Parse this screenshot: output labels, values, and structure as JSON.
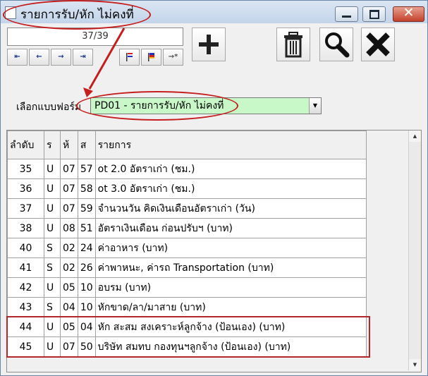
{
  "window": {
    "title": "รายการรับ/หัก ไม่คงที่",
    "minimize_icon": "minimize-icon",
    "maximize_icon": "maximize-icon",
    "close_symbol": "✕"
  },
  "record_counter": "37/39",
  "navigation": [
    {
      "name": "first-record-button",
      "icon": "first-icon",
      "glyph": "⇤"
    },
    {
      "name": "previous-record-button",
      "icon": "previous-icon",
      "glyph": "←"
    },
    {
      "name": "next-record-button",
      "icon": "next-icon",
      "glyph": "→"
    },
    {
      "name": "last-record-button",
      "icon": "last-icon",
      "glyph": "⇥"
    }
  ],
  "record_tools": [
    {
      "name": "flag-button",
      "icon": "flag-icon"
    },
    {
      "name": "flag-reset-button",
      "icon": "flag-multi-icon"
    },
    {
      "name": "goto-record-button",
      "icon": "goto-icon",
      "glyph": "→*"
    }
  ],
  "toolbar": [
    "add-icon",
    "trash-icon",
    "search-icon",
    "delete-x-icon"
  ],
  "form_selector": {
    "label": "เลือกแบบฟอร์ม",
    "value": "PD01 - รายการรับ/หัก ไม่คงที่",
    "background": "#c8f8c8"
  },
  "grid": {
    "headers": [
      "ลำดับ",
      "ร",
      "ห้",
      "ส",
      "รายการ"
    ],
    "rows": [
      [
        "35",
        "U",
        "07",
        "57",
        "ot 2.0 อัตราเก่า  (ชม.)"
      ],
      [
        "36",
        "U",
        "07",
        "58",
        "ot 3.0 อัตราเก่า  (ชม.)"
      ],
      [
        "37",
        "U",
        "07",
        "59",
        "จำนวนวัน คิดเงินเดือนอัตราเก่า  (วัน)"
      ],
      [
        "38",
        "U",
        "08",
        "51",
        "อัตราเงินเดือน ก่อนปรับฯ  (บาท)"
      ],
      [
        "40",
        "S",
        "02",
        "24",
        "ค่าอาหาร  (บาท)"
      ],
      [
        "41",
        "S",
        "02",
        "26",
        "ค่าพาหนะ, ค่ารถ Transportation  (บาท)"
      ],
      [
        "42",
        "U",
        "05",
        "10",
        "อบรม  (บาท)"
      ],
      [
        "43",
        "S",
        "04",
        "10",
        "หักขาด/ลา/มาสาย  (บาท)"
      ],
      [
        "44",
        "U",
        "05",
        "04",
        "หัก สะสม สงเคราะห์ลูกจ้าง (ป้อนเอง)  (บาท)"
      ],
      [
        "45",
        "U",
        "07",
        "50",
        "บริษัท สมทบ กองทุนฯลูกจ้าง (ป้อนเอง)  (บาท)"
      ]
    ]
  },
  "annotation_color": "#c41e1e"
}
